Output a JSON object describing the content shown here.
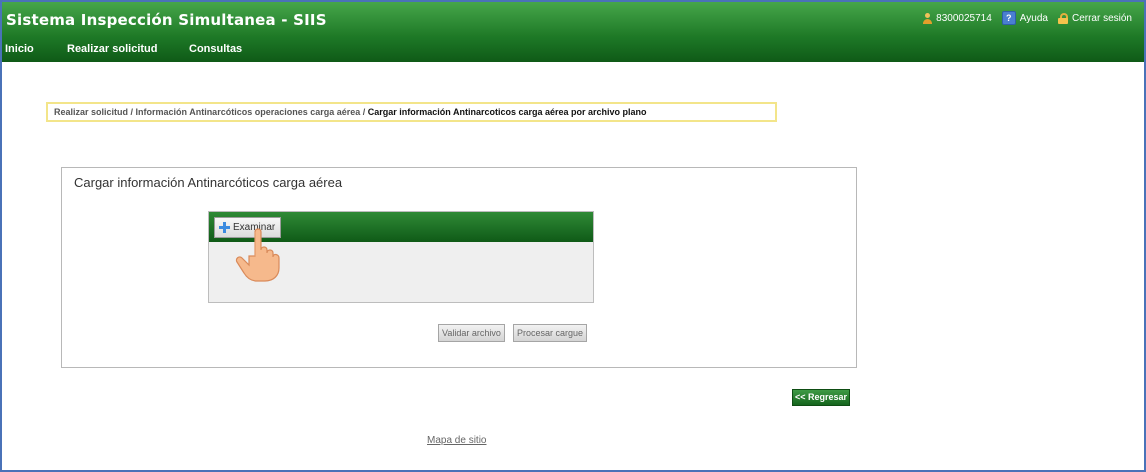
{
  "header": {
    "app_title": "Sistema Inspección Simultanea - SIIS",
    "user_id": "8300025714",
    "help_label": "Ayuda",
    "logout_label": "Cerrar sesión"
  },
  "nav": {
    "items": [
      {
        "label": "Inicio"
      },
      {
        "label": "Realizar solicitud"
      },
      {
        "label": "Consultas"
      }
    ]
  },
  "breadcrumb": {
    "path": "Realizar solicitud / Información Antinarcóticos operaciones carga aérea /",
    "current": "Cargar información Antinarcoticos carga aérea por archivo plano"
  },
  "panel": {
    "title": "Cargar información Antinarcóticos carga aérea",
    "examinar_label": "Examinar",
    "validate_label": "Validar archivo",
    "process_label": "Procesar cargue"
  },
  "footer": {
    "regresar_label": "<< Regresar",
    "sitemap_label": "Mapa de sitio"
  },
  "colors": {
    "header_green": "#1f7a27",
    "nav_green": "#0f5a17",
    "breadcrumb_border": "#f3e58a",
    "frame_blue": "#4a72b8"
  },
  "icons": {
    "user": "user-icon",
    "help": "help-icon",
    "logout": "lock-icon",
    "add": "plus-icon",
    "cursor": "hand-pointer-icon"
  }
}
